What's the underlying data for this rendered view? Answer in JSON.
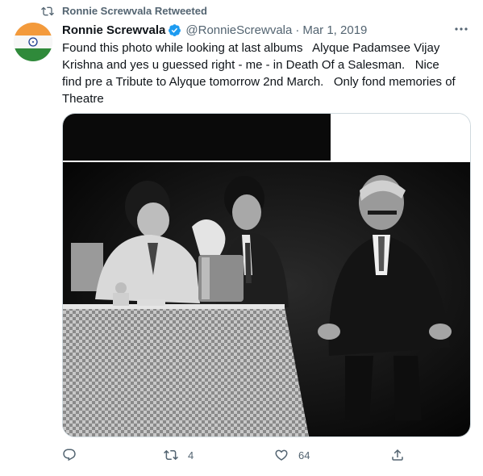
{
  "context": {
    "label": "Ronnie Screwvala Retweeted",
    "icon": "retweet-icon"
  },
  "author": {
    "name": "Ronnie Screwvala",
    "handle": "@RonnieScrewvala",
    "separator": "·",
    "date": "Mar 1, 2019",
    "avatar_icon": "india-flag-avatar"
  },
  "tweet": {
    "text": "Found this photo while looking at last albums   Alyque Padamsee Vijay Krishna and yes u guessed right - me - in Death Of a Salesman.   Nice find pre a Tribute to Alyque tomorrow 2nd March.   Only fond memories of Theatre"
  },
  "actions": {
    "reply": {
      "icon": "reply-icon",
      "count": ""
    },
    "retweet": {
      "icon": "retweet-icon",
      "count": "4"
    },
    "like": {
      "icon": "heart-icon",
      "count": "64"
    },
    "share": {
      "icon": "share-icon"
    }
  },
  "colors": {
    "secondary_text": "#536471",
    "primary_text": "#0f1419",
    "verified_blue": "#1d9bf0",
    "border": "#cfd9de"
  }
}
